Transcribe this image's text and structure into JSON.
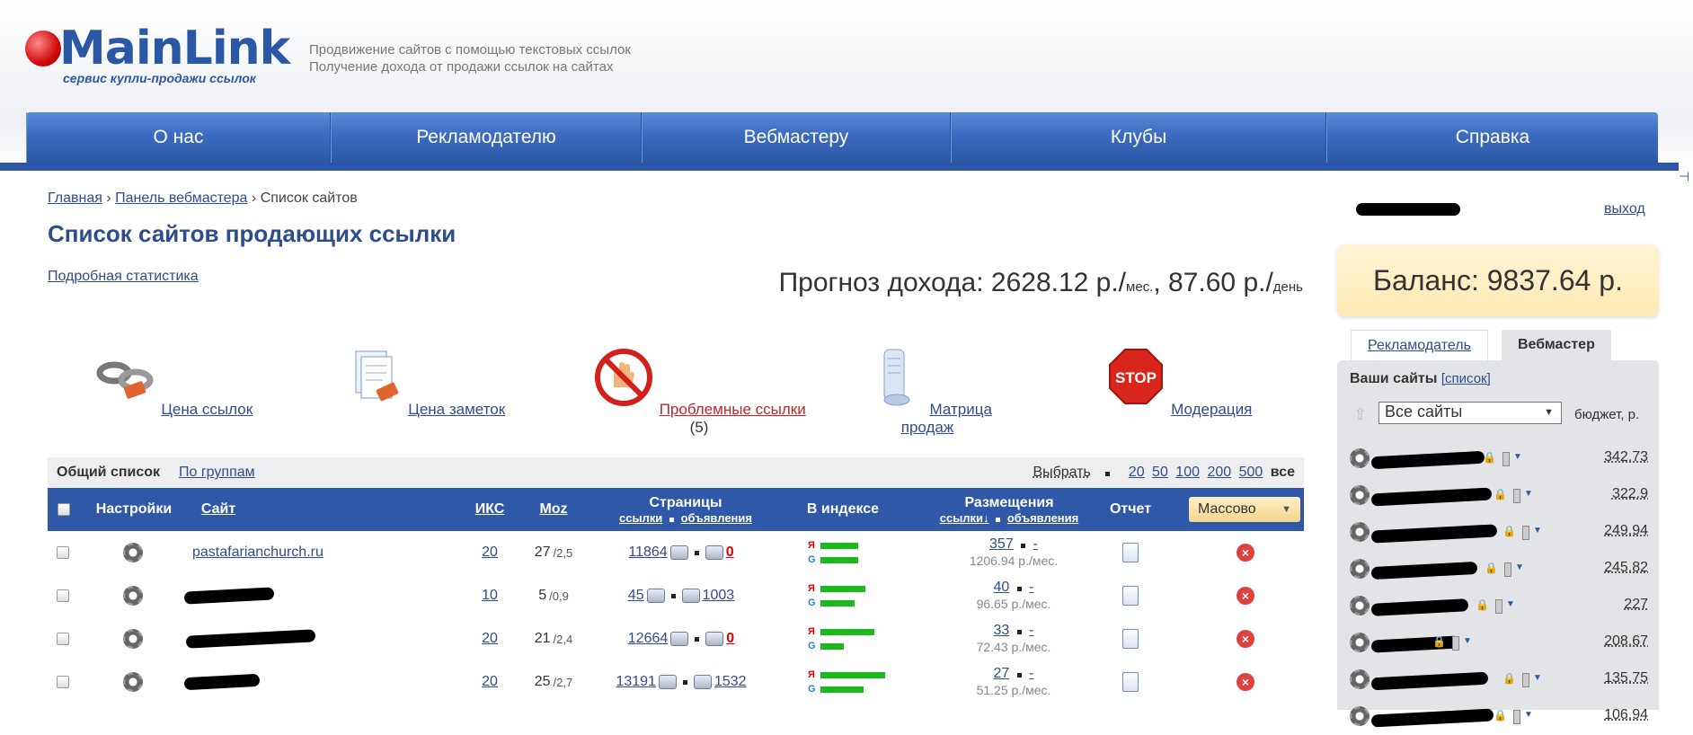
{
  "header": {
    "logo_text": "MainLink",
    "logo_sub": "сервис купли-продажи ссылок",
    "tagline1": "Продвижение сайтов с помощью текстовых ссылок",
    "tagline2": "Получение дохода от продажи ссылок на сайтах"
  },
  "nav": [
    "О нас",
    "Рекламодателю",
    "Вебмастеру",
    "Клубы",
    "Справка"
  ],
  "breadcrumb": {
    "home": "Главная",
    "panel": "Панель вебмастера",
    "current": "Список сайтов",
    "sep": "›"
  },
  "page_title": "Список сайтов продающих ссылки",
  "stats_link": "Подробная статистика",
  "forecast": {
    "prefix": "Прогноз дохода: 2628.12 р./",
    "unit1": "мес.",
    "mid": ", 87.60 р./",
    "unit2": "день"
  },
  "icons": [
    {
      "label": "Цена ссылок",
      "icon": "chain-link-icon"
    },
    {
      "label": "Цена заметок",
      "icon": "notes-price-icon"
    },
    {
      "label": "Проблемные ссылки",
      "count": "(5)",
      "icon": "stop-hand-icon"
    },
    {
      "label": "Матрица продаж",
      "icon": "scroll-icon"
    },
    {
      "label": "Модерация",
      "icon": "stop-sign-icon"
    }
  ],
  "list_bar": {
    "all": "Общий список",
    "groups": "По группам",
    "select": "Выбрать",
    "counts": [
      "20",
      "50",
      "100",
      "200",
      "500"
    ],
    "all_count": "все"
  },
  "table_head": {
    "settings": "Настройки",
    "site": "Сайт",
    "iks": "ИКС",
    "moz": "Moz",
    "pages": "Страницы",
    "pages_links": "ссылки",
    "pages_ads": "объявления",
    "index": "В индексе",
    "placements": "Размещения",
    "pl_links": "ссылки↓",
    "pl_ads": "объявления",
    "report": "Отчет",
    "mass": "Массово"
  },
  "rows": [
    {
      "site": "pastafarianchurch.ru",
      "iks": "20",
      "moz": "27",
      "moz_sub": "/2,5",
      "pages_links": "11864",
      "pages_ads": "0",
      "ads_red": true,
      "ya": 0.35,
      "g": 0.35,
      "pl_links": "357",
      "pl_ads": "-",
      "price": "1206.94 р./мес."
    },
    {
      "site": "",
      "iks": "10",
      "moz": "5",
      "moz_sub": "/0,9",
      "pages_links": "45",
      "pages_ads": "1003",
      "ads_red": false,
      "ya": 0.42,
      "g": 0.32,
      "pl_links": "40",
      "pl_ads": "-",
      "price": "96.65 р./мес."
    },
    {
      "site": "",
      "iks": "20",
      "moz": "21",
      "moz_sub": "/2,4",
      "pages_links": "12664",
      "pages_ads": "0",
      "ads_red": true,
      "ya": 0.5,
      "g": 0.22,
      "pl_links": "33",
      "pl_ads": "-",
      "price": "72.43 р./мес."
    },
    {
      "site": "",
      "iks": "20",
      "moz": "25",
      "moz_sub": "/2,7",
      "pages_links": "13191",
      "pages_ads": "1532",
      "ads_red": false,
      "ya": 0.6,
      "g": 0.4,
      "pl_links": "27",
      "pl_ads": "-",
      "price": "51.25 р./мес."
    }
  ],
  "sidebar": {
    "logout": "выход",
    "balance": "Баланс: 9837.64 р.",
    "tab_adv": "Рекламодатель",
    "tab_web": "Вебмастер",
    "your_sites": "Ваши сайты",
    "list_link": "[список]",
    "select_value": "Все сайты",
    "budget": "бюджет, р.",
    "budgets": [
      "342.73",
      "322.9",
      "249.94",
      "245.82",
      "227",
      "208.67",
      "135.75",
      "106.94"
    ]
  }
}
